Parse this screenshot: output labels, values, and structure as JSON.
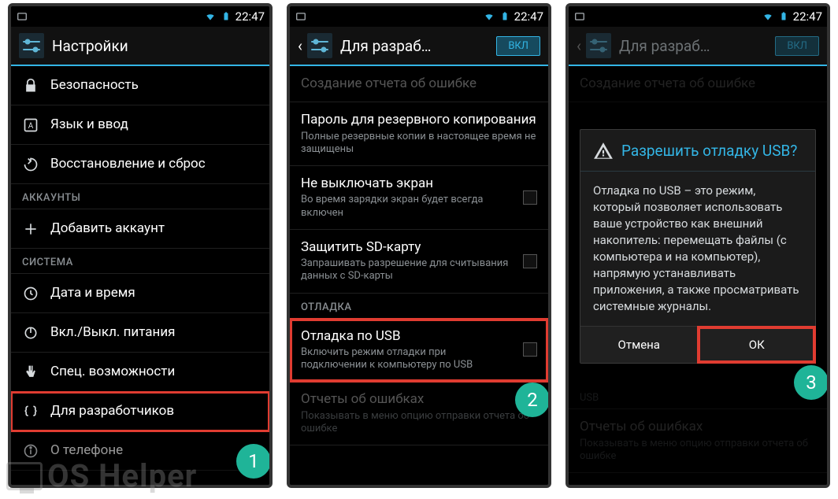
{
  "status": {
    "time": "22:47"
  },
  "screen1": {
    "title": "Настройки",
    "items": [
      {
        "icon": "lock-icon",
        "label": "Безопасность"
      },
      {
        "icon": "lang-icon",
        "label": "Язык и ввод"
      },
      {
        "icon": "restore-icon",
        "label": "Восстановление и сброс"
      }
    ],
    "accounts_header": "АККАУНТЫ",
    "add_account": "Добавить аккаунт",
    "system_header": "СИСТЕМА",
    "system_items": [
      {
        "icon": "clock-icon",
        "label": "Дата и время"
      },
      {
        "icon": "power-icon",
        "label": "Вкл./Выкл. питания"
      },
      {
        "icon": "hand-icon",
        "label": "Спец. возможности"
      },
      {
        "icon": "braces-icon",
        "label": "Для разработчиков"
      },
      {
        "icon": "info-icon",
        "label": "О телефоне"
      }
    ]
  },
  "screen2": {
    "title": "Для разраб…",
    "toggle": "ВКЛ",
    "rows": [
      {
        "label": "Создание отчета об ошибке",
        "sub": "",
        "dim": true
      },
      {
        "label": "Пароль для резервного копирования",
        "sub": "Полные резервные копии в настоящее время не защищены"
      },
      {
        "label": "Не выключать экран",
        "sub": "Во время зарядки экран будет всегда включен",
        "checkbox": true
      },
      {
        "label": "Защитить SD-карту",
        "sub": "Запрашивать разрешение для считывания данных с SD-карты",
        "checkbox": true
      }
    ],
    "debug_header": "ОТЛАДКА",
    "usb_row": {
      "label": "Отладка по USB",
      "sub": "Включить режим отладки при подключении к компьютеру по USB",
      "checkbox": true
    },
    "reports_row": {
      "label": "Отчеты об ошибках",
      "sub": "Показывать в меню опцию отправки отчета об ошибке"
    }
  },
  "screen3": {
    "title": "Для разраб…",
    "toggle": "ВКЛ",
    "bg_rows": [
      {
        "label": "Создание отчета об ошибке"
      }
    ],
    "dialog": {
      "title": "Разрешить отладку USB?",
      "body": "Отладка по USB – это режим, который позволяет использовать ваше устройство как внешний накопитель: перемещать файлы (с компьютера и на компьютер), напрямую устанавливать приложения, а также просматривать системные журналы.",
      "cancel": "Отмена",
      "ok": "ОК"
    },
    "below_usb": "USB",
    "reports_row": {
      "label": "Отчеты об ошибках",
      "sub": "Показывать в меню опцию отправки отчета об ошибке"
    }
  },
  "steps": {
    "one": "1",
    "two": "2",
    "three": "3"
  },
  "watermark": "OS Helper"
}
